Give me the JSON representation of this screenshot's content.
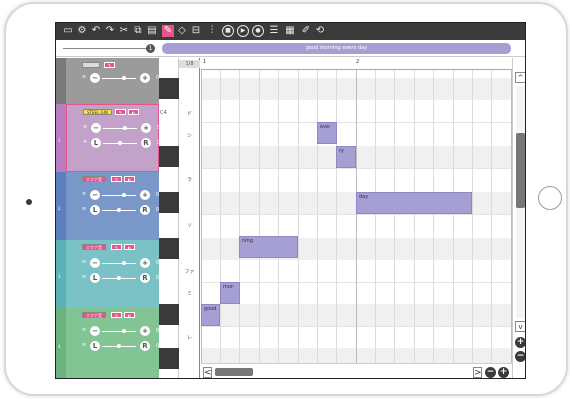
{
  "toolbar": {
    "icons": [
      "new-file-icon",
      "settings-icon",
      "undo-icon",
      "redo-icon",
      "cut-icon",
      "copy-icon",
      "paste-icon",
      "pencil-icon",
      "eraser-icon",
      "select-icon",
      "split-icon",
      "stop-icon",
      "play-icon",
      "record-icon",
      "list-icon",
      "grid-icon",
      "edit-icon",
      "loop-icon"
    ]
  },
  "lyric": {
    "text": "good morning every day"
  },
  "tracks": [
    {
      "title": "",
      "side": "",
      "color": "#9b9b9b",
      "side_color": "#7a7a7a"
    },
    {
      "title": "STEEL GIN",
      "side": "1",
      "color": "#c2a2c9",
      "side_color": "#b77fbf"
    },
    {
      "title": "ミクナ音",
      "side": "2",
      "color": "#7a97c9",
      "side_color": "#5e7fbd"
    },
    {
      "title": "ミクナ音",
      "side": "3",
      "color": "#7bc2c6",
      "side_color": "#5bb3b8"
    },
    {
      "title": "ミクナ音",
      "side": "4",
      "color": "#82c493",
      "side_color": "#6bb47e"
    }
  ],
  "track_values": {
    "volume": "0.0",
    "pan": "0.0"
  },
  "track_buttons": {
    "minus": "−",
    "plus": "+",
    "left": "L",
    "right": "R"
  },
  "piano": {
    "c4_label": "C4",
    "key_labels": [
      "ド",
      "シ",
      "ラ",
      "ソ",
      "ファ",
      "ミ",
      "レ"
    ]
  },
  "ruler": {
    "bar1": "1",
    "bar2": "2",
    "top_label": "1/8"
  },
  "notes": [
    {
      "lyric": "good"
    },
    {
      "lyric": "mor-"
    },
    {
      "lyric": "ning"
    },
    {
      "lyric": "eve-"
    },
    {
      "lyric": "ry"
    },
    {
      "lyric": "day"
    }
  ],
  "scroll": {
    "up": "^",
    "down": "v",
    "left": "<",
    "right": ">",
    "zoom_in": "+",
    "zoom_out": "−"
  }
}
